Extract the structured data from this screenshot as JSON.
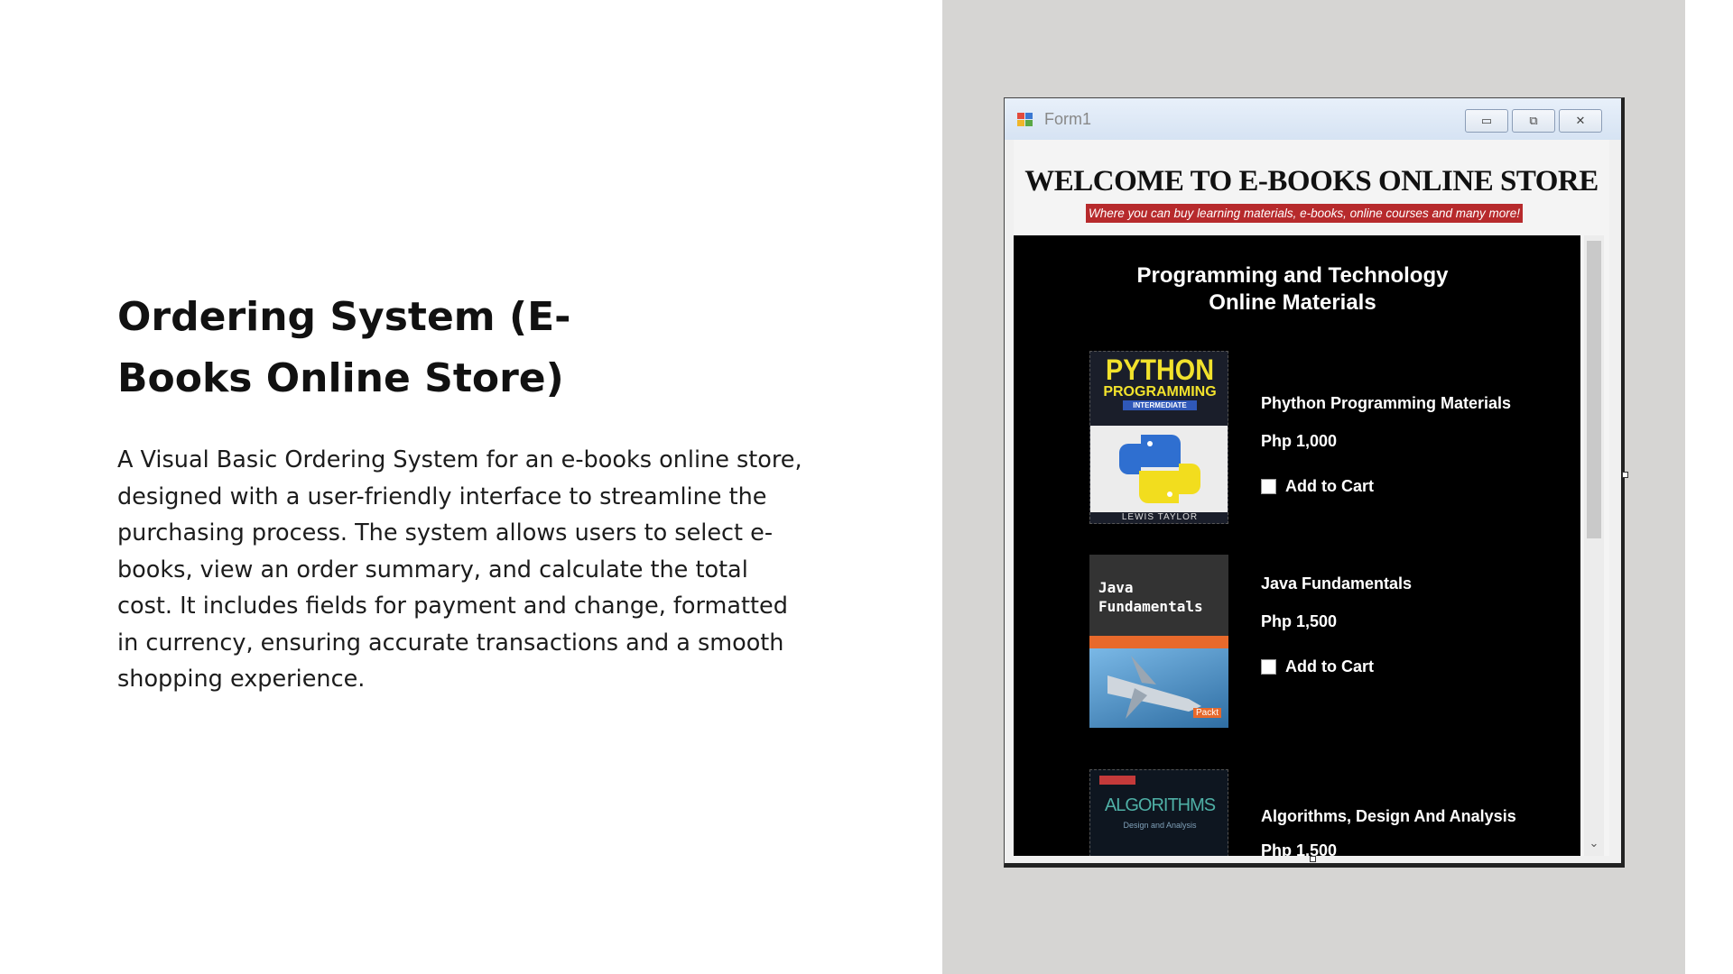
{
  "slide": {
    "title": "Ordering System (E-Books Online Store)",
    "description": "A Visual Basic Ordering System for an e-books online store, designed with a user-friendly interface to streamline the purchasing process. The system allows users to select e-books, view an order summary, and calculate the total cost. It includes fields for payment and change, formatted in currency, ensuring accurate transactions and a smooth shopping experience."
  },
  "window": {
    "title": "Form1",
    "controls": {
      "minimize": "▭",
      "maximize": "⧉",
      "close": "✕"
    }
  },
  "store": {
    "title": "WELCOME TO E-BOOKS ONLINE STORE",
    "tagline": "Where you can buy learning materials, e-books, online courses and many more!"
  },
  "panel": {
    "heading": "Programming and Technology Online Materials",
    "cart_label": "Add to Cart",
    "items": [
      {
        "name": "Phython Programming Materials",
        "price": "Php 1,000",
        "cover": {
          "line1": "PYTHON",
          "line2": "PROGRAMMING",
          "line3": "INTERMEDIATE",
          "author": "LEWIS TAYLOR"
        }
      },
      {
        "name": "Java Fundamentals",
        "price": "Php 1,500",
        "cover": {
          "title": "Java Fundamentals",
          "publisher": "Packt"
        }
      },
      {
        "name": "Algorithms, Design And Analysis",
        "price": "Php 1,500",
        "cover": {
          "title": "ALGORITHMS",
          "subtitle": "Design and Analysis"
        }
      }
    ]
  },
  "colors": {
    "pane_gray": "#d6d5d3",
    "tagline_red": "#b72a2c",
    "python_yellow": "#f2e22c",
    "java_orange": "#e8692b"
  }
}
